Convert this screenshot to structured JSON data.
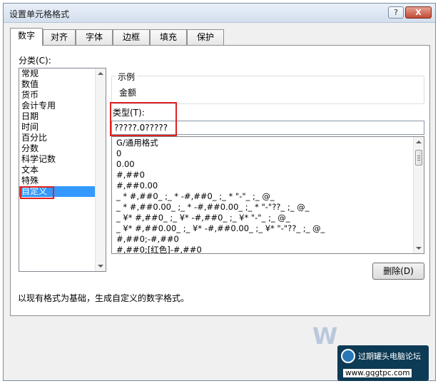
{
  "dialog": {
    "title": "设置单元格格式",
    "help_label": "?",
    "close_label": "X"
  },
  "tabs": [
    {
      "label": "数字"
    },
    {
      "label": "对齐"
    },
    {
      "label": "字体"
    },
    {
      "label": "边框"
    },
    {
      "label": "填充"
    },
    {
      "label": "保护"
    }
  ],
  "category": {
    "label": "分类(C):",
    "items": [
      "常规",
      "数值",
      "货币",
      "会计专用",
      "日期",
      "时间",
      "百分比",
      "分数",
      "科学记数",
      "文本",
      "特殊",
      "自定义"
    ],
    "selected": "自定义"
  },
  "sample": {
    "label": "示例",
    "value": "金额"
  },
  "type": {
    "label": "类型(T):",
    "value": "?????.0?????"
  },
  "formats": [
    "G/通用格式",
    "0",
    "0.00",
    "#,##0",
    "#,##0.00",
    "_ * #,##0_ ;_ * -#,##0_ ;_ * \"-\"_ ;_ @_",
    "_ * #,##0.00_ ;_ * -#,##0.00_ ;_ * \"-\"??_ ;_ @_",
    "_ ¥* #,##0_ ;_ ¥* -#,##0_ ;_ ¥* \"-\"_ ;_ @_",
    "_ ¥* #,##0.00_ ;_ ¥* -#,##0.00_ ;_ ¥* \"-\"??_ ;_ @_",
    "#,##0;-#,##0",
    "#,##0;[红色]-#,##0"
  ],
  "delete_button": "删除(D)",
  "description": "以现有格式为基础，生成自定义的数字格式。",
  "watermark": {
    "badge_title": "过期罐头电脑论坛",
    "url": "www.gqgtpc.com"
  },
  "colors": {
    "selection": "#3399ff",
    "highlight_box": "#e02020",
    "close_button": "#c24a33"
  }
}
